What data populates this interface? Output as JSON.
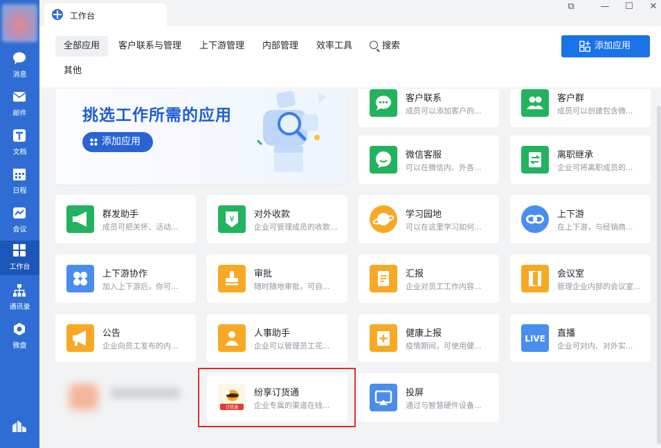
{
  "window": {
    "tab_title": "工作台"
  },
  "sidebar": {
    "items": [
      {
        "label": "消息",
        "icon": "chat-bubble-icon"
      },
      {
        "label": "邮件",
        "icon": "mail-icon"
      },
      {
        "label": "文档",
        "icon": "doc-icon"
      },
      {
        "label": "日程",
        "icon": "calendar-icon"
      },
      {
        "label": "会议",
        "icon": "meeting-icon"
      },
      {
        "label": "工作台",
        "icon": "grid-icon",
        "active": true
      },
      {
        "label": "通讯录",
        "icon": "org-chart-icon"
      },
      {
        "label": "微盘",
        "icon": "cloud-drive-icon"
      }
    ]
  },
  "tabs": [
    "全部应用",
    "客户联系与管理",
    "上下游管理",
    "内部管理",
    "效率工具",
    "搜索",
    "其他"
  ],
  "add_app_button": "添加应用",
  "banner": {
    "title": "挑选工作所需的应用",
    "button": "添加应用"
  },
  "apps": [
    {
      "name": "客户联系",
      "desc": "成员可以添加客户的...",
      "color": "#22b35e",
      "icon": "chat-icon"
    },
    {
      "name": "客户群",
      "desc": "成员可以创建包含微...",
      "color": "#22b35e",
      "icon": "people-icon"
    },
    {
      "name": "微信客服",
      "desc": "可以在微信内、外各...",
      "color": "#22b35e",
      "icon": "service-chat-icon"
    },
    {
      "name": "离职继承",
      "desc": "企业可将离职成员的...",
      "color": "#22b35e",
      "icon": "transfer-icon"
    },
    {
      "name": "群发助手",
      "desc": "成员可把关怀、活动...",
      "color": "#22b35e",
      "icon": "megaphone-icon"
    },
    {
      "name": "对外收款",
      "desc": "企业可管理成员的收款...",
      "color": "#22b35e",
      "icon": "yen-shield-icon"
    },
    {
      "name": "学习园地",
      "desc": "可以在这里学习如何...",
      "color": "#f7a925",
      "icon": "planet-icon"
    },
    {
      "name": "上下游",
      "desc": "在上下游，与经销商...",
      "color": "#4a8df0",
      "icon": "link-icon"
    },
    {
      "name": "上下游协作",
      "desc": "加入上下游后，你可...",
      "color": "#4a8df0",
      "icon": "clover-icon"
    },
    {
      "name": "审批",
      "desc": "随时随地审批，可自...",
      "color": "#f7a925",
      "icon": "stamp-icon"
    },
    {
      "name": "汇报",
      "desc": "企业对员工工作内容...",
      "color": "#f7a925",
      "icon": "report-icon"
    },
    {
      "name": "会议室",
      "desc": "管理企业内部的会议室...",
      "color": "#f7a925",
      "icon": "door-icon"
    },
    {
      "name": "公告",
      "desc": "企业向员工发布的内...",
      "color": "#f7a925",
      "icon": "announce-icon"
    },
    {
      "name": "人事助手",
      "desc": "企业可以管理员工花...",
      "color": "#f7a925",
      "icon": "person-icon"
    },
    {
      "name": "健康上报",
      "desc": "疫情期间，可使用健...",
      "color": "#f7a925",
      "icon": "health-icon"
    },
    {
      "name": "直播",
      "desc": "企业可对内、对外实...",
      "color": "#4a8df0",
      "icon": "live-icon",
      "badge": "LIVE"
    },
    {
      "name": "纷享订货通",
      "desc": "企业专属的渠道在线...",
      "color": "#ffffff",
      "icon": "bee-logo-icon",
      "badge": "订货通"
    },
    {
      "name": "投屏",
      "desc": "通过与智慧硬件设备...",
      "color": "#4a8df0",
      "icon": "screen-cast-icon"
    }
  ]
}
